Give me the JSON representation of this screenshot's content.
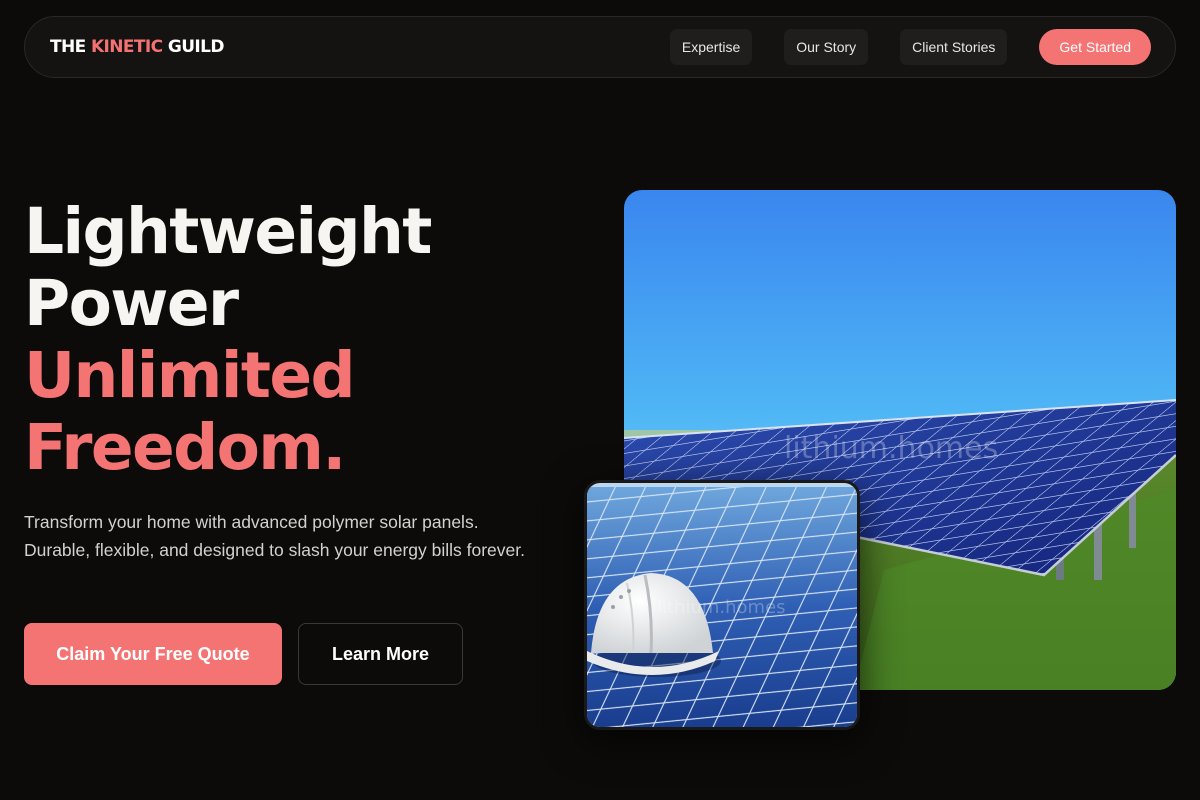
{
  "brand": {
    "part1": "THE ",
    "part2": "KINETIC",
    "part3": " GUILD",
    "accent_color": "#f47474"
  },
  "nav": {
    "links": [
      "Expertise",
      "Our Story",
      "Client Stories"
    ],
    "cta": "Get Started"
  },
  "hero": {
    "line1": "Lightweight",
    "line2": "Power",
    "line3": "Unlimited",
    "line4": "Freedom.",
    "subtitle": "Transform your home with advanced polymer solar panels. Durable, flexible, and designed to slash your energy bills forever.",
    "primary_button": "Claim Your Free Quote",
    "secondary_button": "Learn More"
  },
  "images": {
    "main": {
      "subject": "solar panel array on grassy field under blue sky",
      "watermark": "lithium.homes"
    },
    "inset": {
      "subject": "white hard hat resting on solar panels",
      "watermark": "lithium.homes"
    }
  }
}
